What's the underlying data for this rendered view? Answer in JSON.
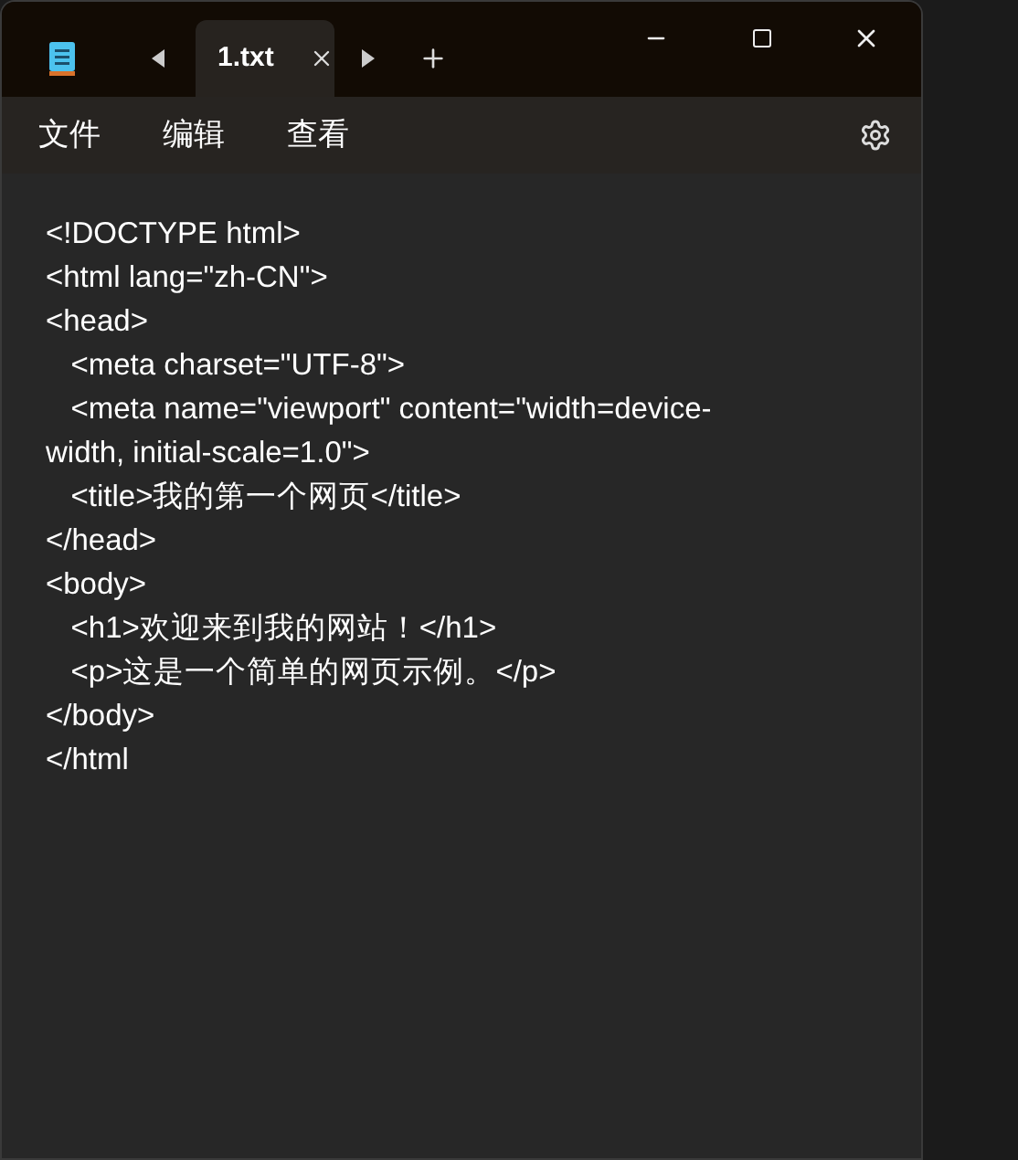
{
  "tabs": [
    {
      "label": "1.txt",
      "selected": true
    }
  ],
  "menu": [
    "文件",
    "编辑",
    "查看"
  ],
  "lines": [
    "<!DOCTYPE html>",
    "<html lang=\"zh-CN\">",
    "<head>",
    "   <meta charset=\"UTF-8\">",
    "   <meta name=\"viewport\" content=\"width=device-",
    "width, initial-scale=1.0\">",
    "   <title>我的第一个网页</title>",
    "</head>",
    "<body>",
    "   <h1>欢迎来到我的网站！</h1>",
    "   <p>这是一个简单的网页示例。</p>",
    "</body>",
    "</html"
  ]
}
